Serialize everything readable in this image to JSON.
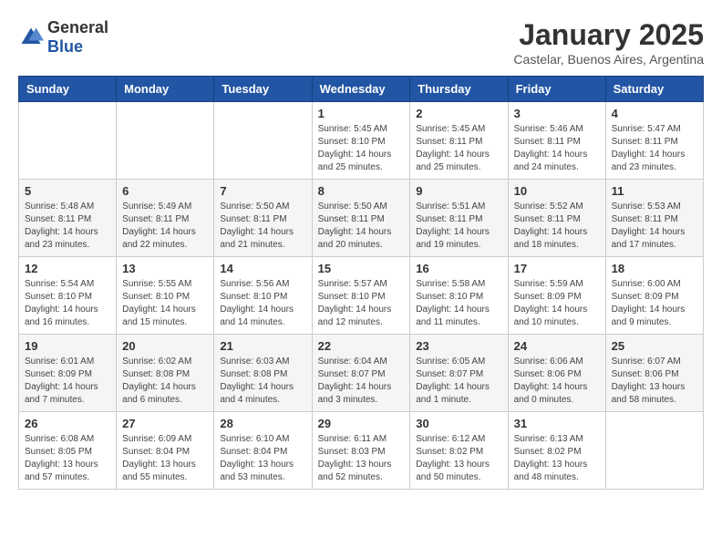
{
  "logo": {
    "general": "General",
    "blue": "Blue"
  },
  "header": {
    "month": "January 2025",
    "location": "Castelar, Buenos Aires, Argentina"
  },
  "weekdays": [
    "Sunday",
    "Monday",
    "Tuesday",
    "Wednesday",
    "Thursday",
    "Friday",
    "Saturday"
  ],
  "weeks": [
    [
      null,
      null,
      null,
      {
        "day": 1,
        "sunrise": "5:45 AM",
        "sunset": "8:10 PM",
        "daylight": "14 hours and 25 minutes."
      },
      {
        "day": 2,
        "sunrise": "5:45 AM",
        "sunset": "8:11 PM",
        "daylight": "14 hours and 25 minutes."
      },
      {
        "day": 3,
        "sunrise": "5:46 AM",
        "sunset": "8:11 PM",
        "daylight": "14 hours and 24 minutes."
      },
      {
        "day": 4,
        "sunrise": "5:47 AM",
        "sunset": "8:11 PM",
        "daylight": "14 hours and 23 minutes."
      }
    ],
    [
      {
        "day": 5,
        "sunrise": "5:48 AM",
        "sunset": "8:11 PM",
        "daylight": "14 hours and 23 minutes."
      },
      {
        "day": 6,
        "sunrise": "5:49 AM",
        "sunset": "8:11 PM",
        "daylight": "14 hours and 22 minutes."
      },
      {
        "day": 7,
        "sunrise": "5:50 AM",
        "sunset": "8:11 PM",
        "daylight": "14 hours and 21 minutes."
      },
      {
        "day": 8,
        "sunrise": "5:50 AM",
        "sunset": "8:11 PM",
        "daylight": "14 hours and 20 minutes."
      },
      {
        "day": 9,
        "sunrise": "5:51 AM",
        "sunset": "8:11 PM",
        "daylight": "14 hours and 19 minutes."
      },
      {
        "day": 10,
        "sunrise": "5:52 AM",
        "sunset": "8:11 PM",
        "daylight": "14 hours and 18 minutes."
      },
      {
        "day": 11,
        "sunrise": "5:53 AM",
        "sunset": "8:11 PM",
        "daylight": "14 hours and 17 minutes."
      }
    ],
    [
      {
        "day": 12,
        "sunrise": "5:54 AM",
        "sunset": "8:10 PM",
        "daylight": "14 hours and 16 minutes."
      },
      {
        "day": 13,
        "sunrise": "5:55 AM",
        "sunset": "8:10 PM",
        "daylight": "14 hours and 15 minutes."
      },
      {
        "day": 14,
        "sunrise": "5:56 AM",
        "sunset": "8:10 PM",
        "daylight": "14 hours and 14 minutes."
      },
      {
        "day": 15,
        "sunrise": "5:57 AM",
        "sunset": "8:10 PM",
        "daylight": "14 hours and 12 minutes."
      },
      {
        "day": 16,
        "sunrise": "5:58 AM",
        "sunset": "8:10 PM",
        "daylight": "14 hours and 11 minutes."
      },
      {
        "day": 17,
        "sunrise": "5:59 AM",
        "sunset": "8:09 PM",
        "daylight": "14 hours and 10 minutes."
      },
      {
        "day": 18,
        "sunrise": "6:00 AM",
        "sunset": "8:09 PM",
        "daylight": "14 hours and 9 minutes."
      }
    ],
    [
      {
        "day": 19,
        "sunrise": "6:01 AM",
        "sunset": "8:09 PM",
        "daylight": "14 hours and 7 minutes."
      },
      {
        "day": 20,
        "sunrise": "6:02 AM",
        "sunset": "8:08 PM",
        "daylight": "14 hours and 6 minutes."
      },
      {
        "day": 21,
        "sunrise": "6:03 AM",
        "sunset": "8:08 PM",
        "daylight": "14 hours and 4 minutes."
      },
      {
        "day": 22,
        "sunrise": "6:04 AM",
        "sunset": "8:07 PM",
        "daylight": "14 hours and 3 minutes."
      },
      {
        "day": 23,
        "sunrise": "6:05 AM",
        "sunset": "8:07 PM",
        "daylight": "14 hours and 1 minute."
      },
      {
        "day": 24,
        "sunrise": "6:06 AM",
        "sunset": "8:06 PM",
        "daylight": "14 hours and 0 minutes."
      },
      {
        "day": 25,
        "sunrise": "6:07 AM",
        "sunset": "8:06 PM",
        "daylight": "13 hours and 58 minutes."
      }
    ],
    [
      {
        "day": 26,
        "sunrise": "6:08 AM",
        "sunset": "8:05 PM",
        "daylight": "13 hours and 57 minutes."
      },
      {
        "day": 27,
        "sunrise": "6:09 AM",
        "sunset": "8:04 PM",
        "daylight": "13 hours and 55 minutes."
      },
      {
        "day": 28,
        "sunrise": "6:10 AM",
        "sunset": "8:04 PM",
        "daylight": "13 hours and 53 minutes."
      },
      {
        "day": 29,
        "sunrise": "6:11 AM",
        "sunset": "8:03 PM",
        "daylight": "13 hours and 52 minutes."
      },
      {
        "day": 30,
        "sunrise": "6:12 AM",
        "sunset": "8:02 PM",
        "daylight": "13 hours and 50 minutes."
      },
      {
        "day": 31,
        "sunrise": "6:13 AM",
        "sunset": "8:02 PM",
        "daylight": "13 hours and 48 minutes."
      },
      null
    ]
  ],
  "labels": {
    "sunrise": "Sunrise:",
    "sunset": "Sunset:",
    "daylight": "Daylight:"
  }
}
